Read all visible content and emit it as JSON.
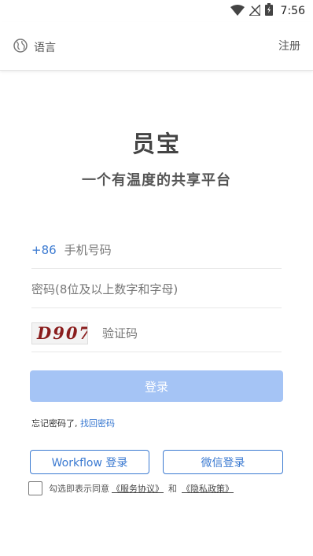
{
  "status_bar": {
    "time": "7:56",
    "icons": [
      "wifi-icon",
      "signal-icon",
      "battery-icon"
    ]
  },
  "top_bar": {
    "language_label": "语言",
    "register_label": "注册"
  },
  "brand": {
    "app_name": "员宝",
    "slogan": "一个有温度的共享平台"
  },
  "form": {
    "country_code": "+86",
    "phone_placeholder": "手机号码",
    "password_placeholder": "密码(8位及以上数字和字母)",
    "captcha_text": "D907",
    "captcha_placeholder": "验证码",
    "login_label": "登录"
  },
  "forgot": {
    "prefix": "忘记密码了, ",
    "link": "找回密码"
  },
  "alt_login": {
    "workflow_label": "Workflow 登录",
    "wechat_label": "微信登录"
  },
  "agreement": {
    "prefix": "勾选即表示同意",
    "service_link": "《服务协议》",
    "and": "和",
    "privacy_link": "《隐私政策》"
  },
  "colors": {
    "accent": "#3b7ad1",
    "login_button": "#a5c4f5",
    "captcha_text": "#8a1d1d"
  }
}
